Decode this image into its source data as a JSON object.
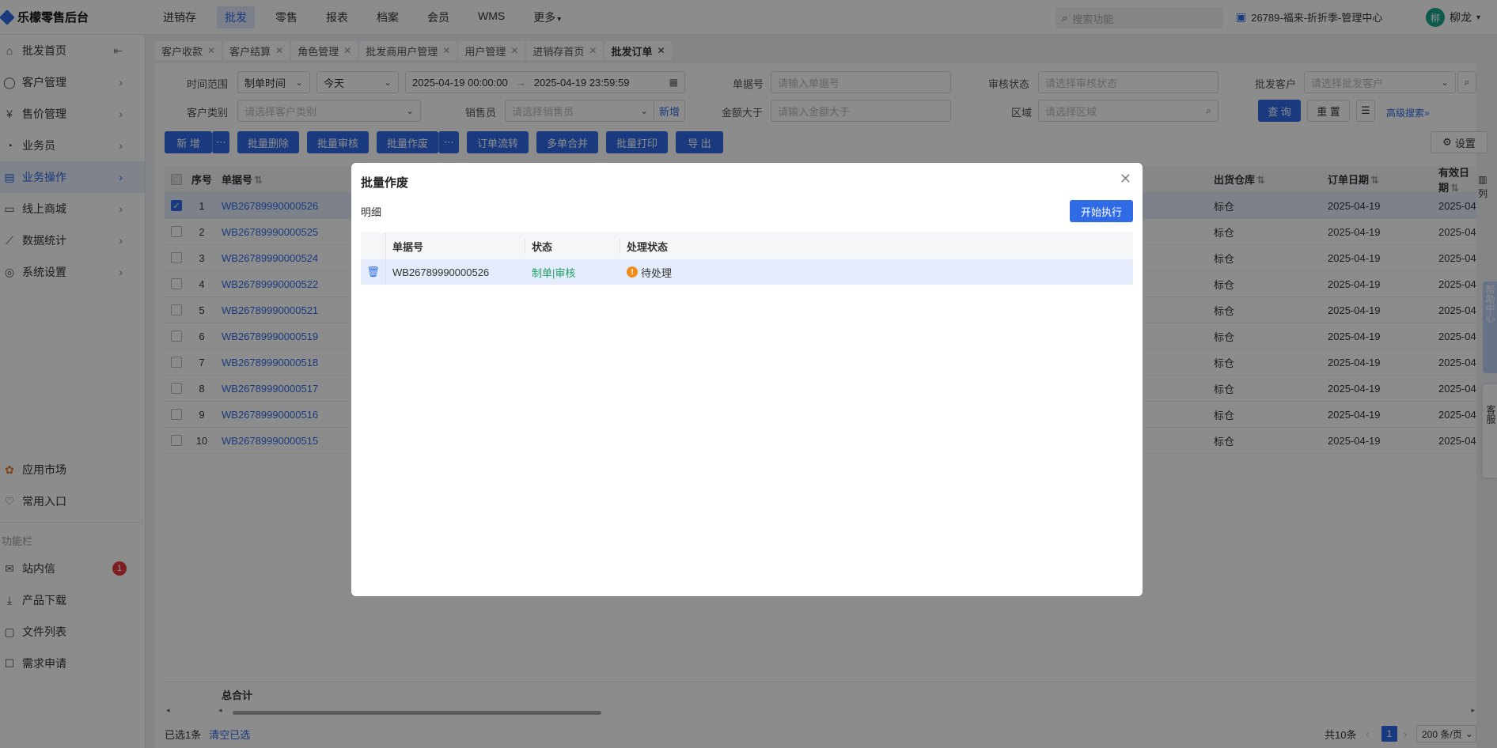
{
  "app": {
    "title": "乐檬零售后台"
  },
  "topnav": [
    "进销存",
    "批发",
    "零售",
    "报表",
    "档案",
    "会员",
    "WMS",
    "更多"
  ],
  "topnav_active": 1,
  "search": {
    "placeholder": "搜索功能"
  },
  "store": {
    "label": "26789-福来-折折季-管理中心"
  },
  "user": {
    "avatar_char": "柳",
    "name": "柳龙"
  },
  "sidebar": {
    "items": [
      {
        "label": "批发首页",
        "name": "wholesale-home"
      },
      {
        "label": "客户管理",
        "name": "customer-mgmt"
      },
      {
        "label": "售价管理",
        "name": "price-mgmt"
      },
      {
        "label": "业务员",
        "name": "salesman"
      },
      {
        "label": "业务操作",
        "name": "business-ops"
      },
      {
        "label": "线上商城",
        "name": "online-mall"
      },
      {
        "label": "数据统计",
        "name": "data-stats"
      },
      {
        "label": "系统设置",
        "name": "system-settings"
      }
    ],
    "bottom": {
      "app_market": "应用市场",
      "common_entry": "常用入口",
      "section_title": "功能栏",
      "inbox": "站内信",
      "inbox_badge": "1",
      "product_download": "产品下载",
      "file_list": "文件列表",
      "demand": "需求申请"
    }
  },
  "tabs": [
    "客户收款",
    "客户结算",
    "角色管理",
    "批发商用户管理",
    "用户管理",
    "进销存首页",
    "批发订单"
  ],
  "filters": {
    "time_range_label": "时间范围",
    "time_type": "制单时间",
    "date_preset": "今天",
    "start": "2025-04-19 00:00:00",
    "end": "2025-04-19 23:59:59",
    "order_no_label": "单据号",
    "order_no_ph": "请输入单据号",
    "audit_label": "审核状态",
    "audit_ph": "请选择审核状态",
    "customer_label": "批发客户",
    "customer_ph": "请选择批发客户",
    "cust_type_label": "客户类别",
    "cust_type_ph": "请选择客户类别",
    "salesman_label": "销售员",
    "salesman_ph": "请选择销售员",
    "salesman_add": "新增",
    "amount_label": "金额大于",
    "amount_ph": "请输入金额大于",
    "region_label": "区域",
    "region_ph": "请选择区域",
    "query": "查 询",
    "reset": "重 置",
    "advanced": "高级搜索"
  },
  "toolbar": {
    "add": "新 增",
    "batch_delete": "批量删除",
    "batch_audit": "批量审核",
    "batch_void": "批量作废",
    "order_flow": "订单流转",
    "merge": "多单合并",
    "batch_print": "批量打印",
    "export": "导 出",
    "settings": "设置"
  },
  "table": {
    "headers": {
      "idx": "序号",
      "no": "单据号",
      "warehouse": "出货仓库",
      "order_date": "订单日期",
      "valid_date": "有效日期"
    },
    "rows": [
      {
        "idx": "1",
        "no": "WB26789990000526",
        "warehouse": "标仓",
        "date": "2025-04-19",
        "valid": "2025-04"
      },
      {
        "idx": "2",
        "no": "WB26789990000525",
        "warehouse": "标仓",
        "date": "2025-04-19",
        "valid": "2025-04"
      },
      {
        "idx": "3",
        "no": "WB26789990000524",
        "warehouse": "标仓",
        "date": "2025-04-19",
        "valid": "2025-04"
      },
      {
        "idx": "4",
        "no": "WB26789990000522",
        "warehouse": "标仓",
        "date": "2025-04-19",
        "valid": "2025-04"
      },
      {
        "idx": "5",
        "no": "WB26789990000521",
        "warehouse": "标仓",
        "date": "2025-04-19",
        "valid": "2025-04"
      },
      {
        "idx": "6",
        "no": "WB26789990000519",
        "warehouse": "标仓",
        "date": "2025-04-19",
        "valid": "2025-04"
      },
      {
        "idx": "7",
        "no": "WB26789990000518",
        "warehouse": "标仓",
        "date": "2025-04-19",
        "valid": "2025-04"
      },
      {
        "idx": "8",
        "no": "WB26789990000517",
        "warehouse": "标仓",
        "date": "2025-04-19",
        "valid": "2025-04"
      },
      {
        "idx": "9",
        "no": "WB26789990000516",
        "warehouse": "标仓",
        "date": "2025-04-19",
        "valid": "2025-04"
      },
      {
        "idx": "10",
        "no": "WB26789990000515",
        "warehouse": "标仓",
        "date": "2025-04-19",
        "valid": "2025-04"
      }
    ],
    "total_label": "总合计",
    "column_btn": "列"
  },
  "status": {
    "selected": "已选1条",
    "clear": "清空已选",
    "total": "共10条",
    "page": "1",
    "page_size": "200 条/页"
  },
  "float": {
    "helper": "帮助中心",
    "service": "客服"
  },
  "modal": {
    "title": "批量作废",
    "subtitle": "明细",
    "run": "开始执行",
    "headers": {
      "no": "单据号",
      "status": "状态",
      "process": "处理状态"
    },
    "rows": [
      {
        "no": "WB26789990000526",
        "status": "制单|审核",
        "process": "待处理"
      }
    ]
  },
  "colors": {
    "primary": "#2f6be5",
    "selected_row": "#e4ecfb",
    "status_green": "#22a06b",
    "warning": "#f08c1c"
  }
}
